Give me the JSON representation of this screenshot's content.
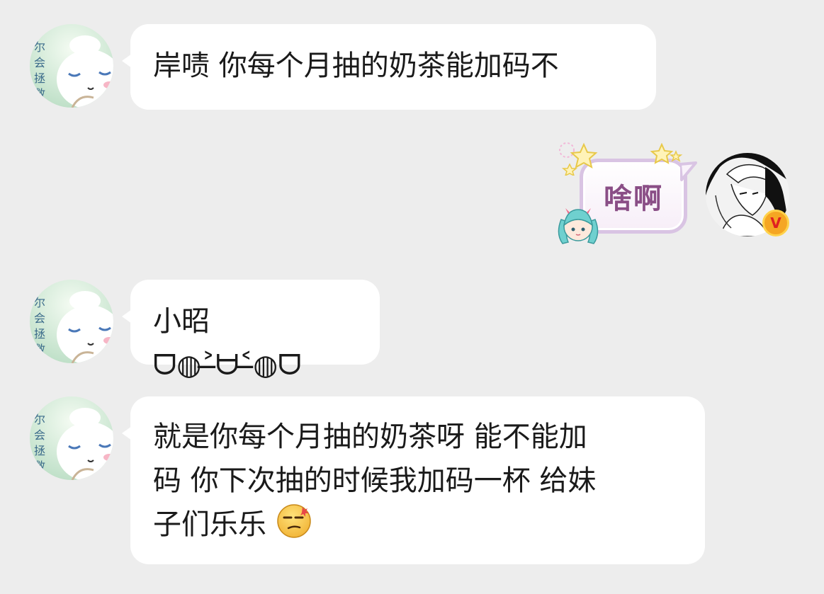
{
  "messages": [
    {
      "sender": "other",
      "text": "岸啧 你每个月抽的奶茶能加码不"
    },
    {
      "sender": "self",
      "text": "啥啊"
    },
    {
      "sender": "other",
      "text": "小昭 ᗜ◍˃̶ᗨ˂̶◍ᗜ"
    },
    {
      "sender": "other",
      "line1": "就是你每个月抽的奶茶呀 能不能加",
      "line2": "码 你下次抽的时候我加码一杯 给妹",
      "line3": "子们乐乐",
      "emoji": "smirk-face-emoji"
    }
  ],
  "avatars": {
    "other_avatar_text": "尔会拯救我",
    "self_badge_label": "V",
    "self_badge_color": "#f5a623"
  },
  "colors": {
    "background": "#ededed",
    "bubble": "#ffffff",
    "text": "#1a1a1a",
    "self_text": "#8a4e86"
  }
}
